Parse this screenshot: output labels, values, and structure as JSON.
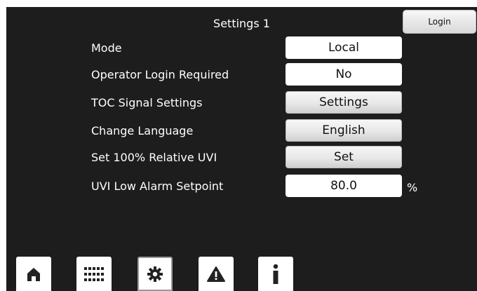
{
  "window": {
    "title": "Settings 1"
  },
  "login": {
    "label": "Login"
  },
  "rows": [
    {
      "label": "Mode",
      "value": "Local",
      "kind": "field"
    },
    {
      "label": "Operator Login Required",
      "value": "No",
      "kind": "field"
    },
    {
      "label": "TOC Signal Settings",
      "value": "Settings",
      "kind": "button"
    },
    {
      "label": "Change Language",
      "value": "English",
      "kind": "button"
    },
    {
      "label": "Set 100% Relative UVI",
      "value": "Set",
      "kind": "button"
    },
    {
      "label": "UVI Low Alarm Setpoint",
      "value": "80.0",
      "kind": "field",
      "unit": "%"
    }
  ],
  "nav": {
    "items": [
      {
        "icon": "home-icon",
        "active": false
      },
      {
        "icon": "keypad-grid-icon",
        "active": false
      },
      {
        "icon": "gear-icon",
        "active": true
      },
      {
        "icon": "warning-icon",
        "active": false
      },
      {
        "icon": "info-icon",
        "active": false
      }
    ]
  },
  "colors": {
    "background": "#1d1d1d",
    "text": "#ffffff",
    "field": "#ffffff",
    "button_gradient_top": "#f6f6f6",
    "button_gradient_bottom": "#cfcfcf"
  }
}
